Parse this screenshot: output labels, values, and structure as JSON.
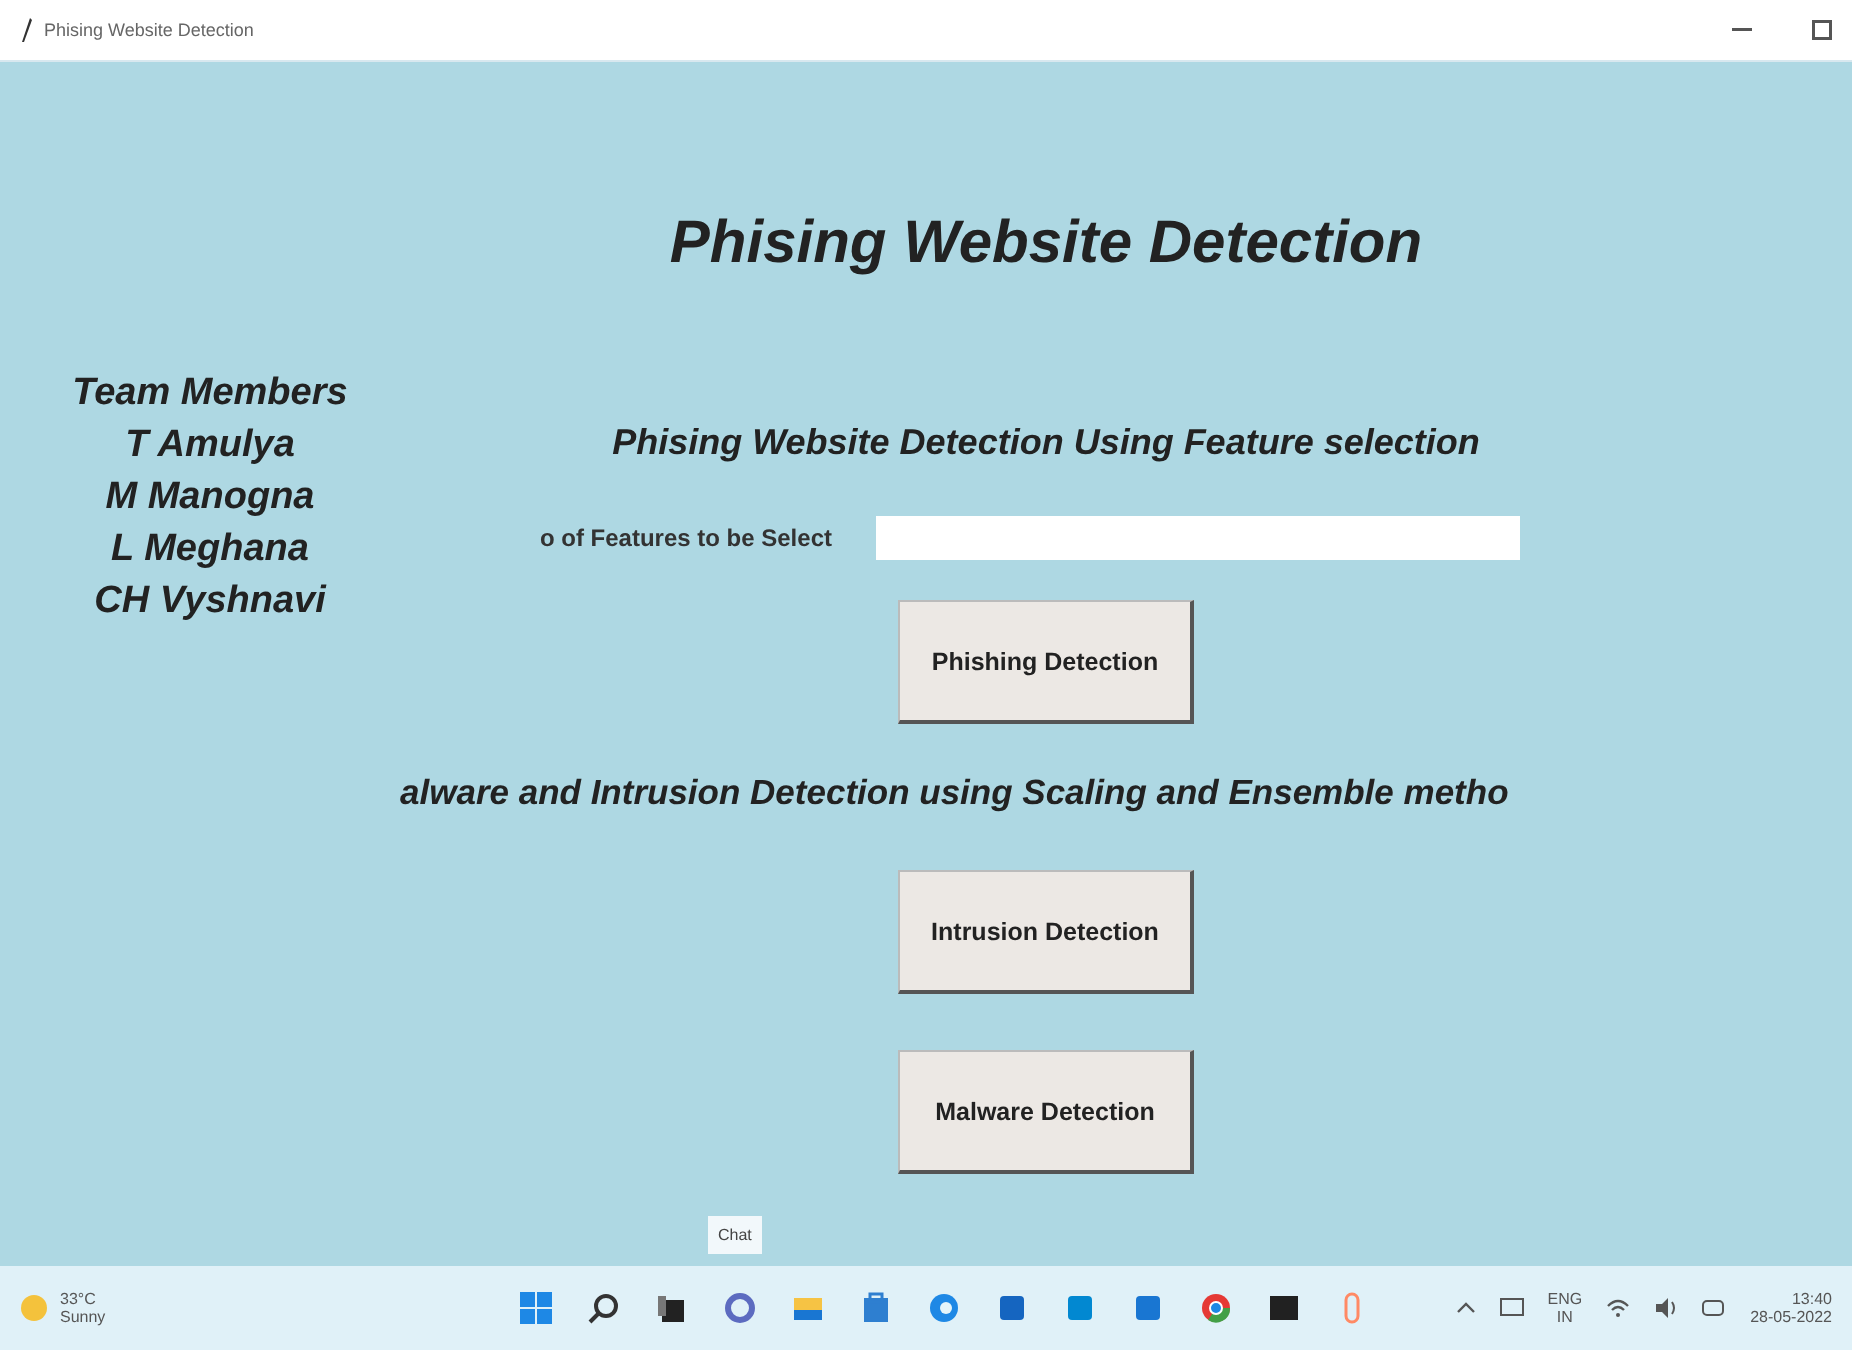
{
  "window": {
    "title": "Phising Website Detection"
  },
  "heading": "Phising Website Detection",
  "team": [
    "Team Members",
    "T Amulya",
    "M Manogna",
    "L Meghana",
    "CH Vyshnavi"
  ],
  "section_1": {
    "title": "Phising Website Detection Using Feature selection",
    "field_label": "o of Features to be Select",
    "button": "Phishing Detection"
  },
  "section_2": {
    "title": "alware and Intrusion Detection using Scaling and Ensemble metho",
    "buttons": [
      "Intrusion Detection",
      "Malware Detection"
    ]
  },
  "tooltip": "Chat",
  "taskbar": {
    "weather": {
      "temp": "33°C",
      "condition": "Sunny"
    },
    "language": {
      "code": "ENG",
      "region": "IN"
    },
    "time": "13:40",
    "date": "28-05-2022"
  }
}
